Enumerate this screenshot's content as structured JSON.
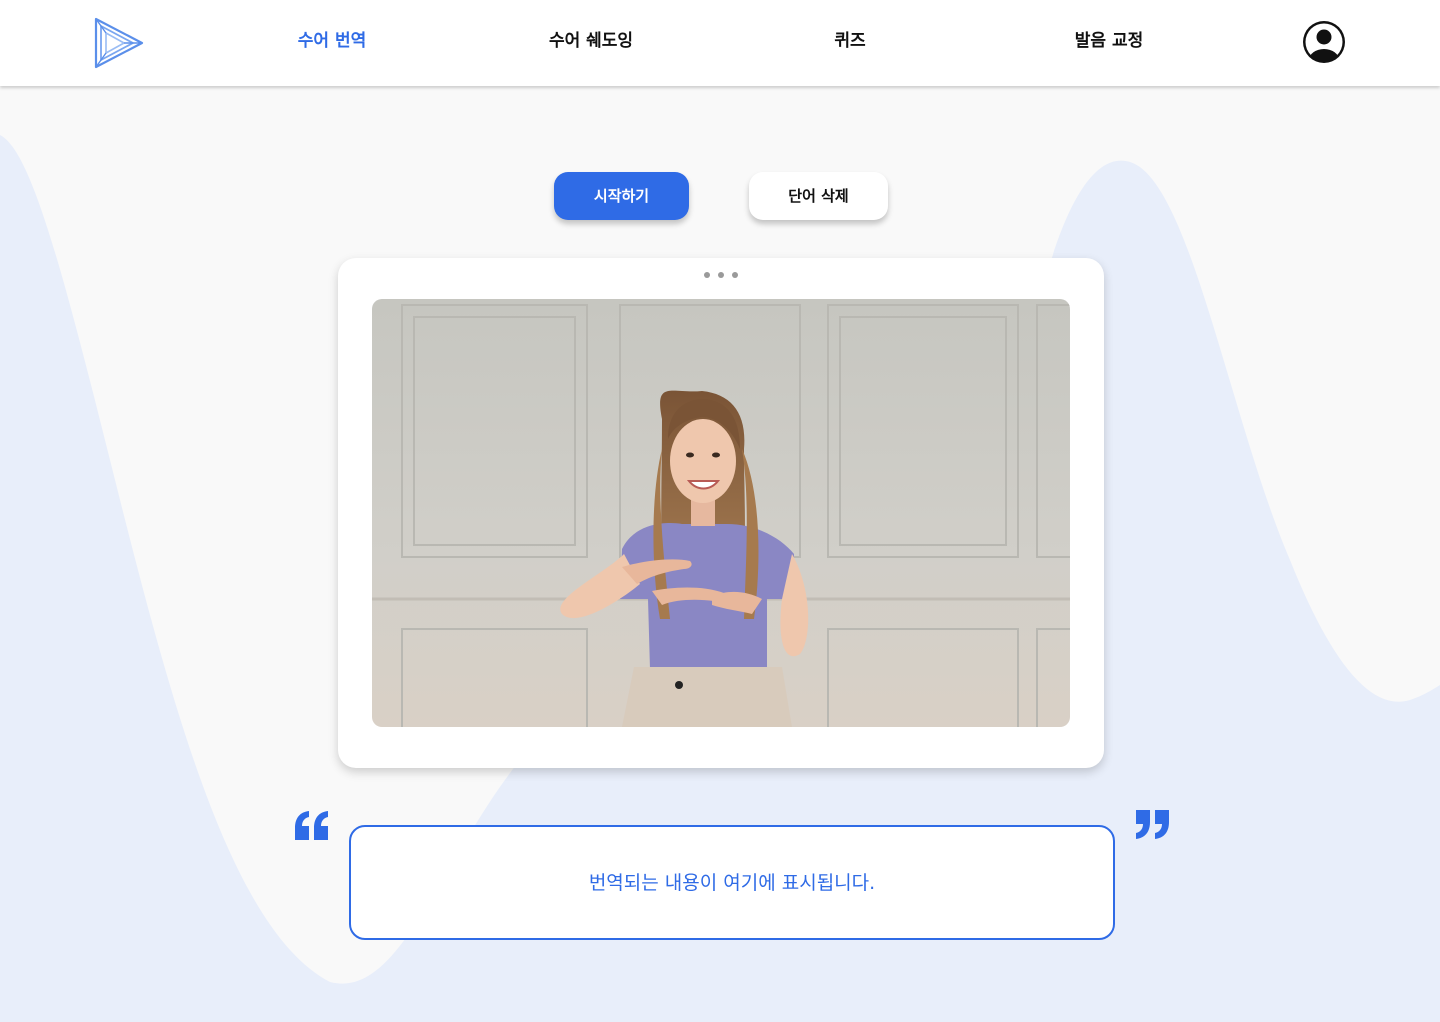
{
  "nav": {
    "items": [
      {
        "label": "수어 번역",
        "active": true
      },
      {
        "label": "수어 쉐도잉",
        "active": false
      },
      {
        "label": "퀴즈",
        "active": false
      },
      {
        "label": "발음 교정",
        "active": false
      }
    ],
    "logo_icon": "play-triangle-logo",
    "profile_icon": "user-avatar-icon"
  },
  "actions": {
    "start_label": "시작하기",
    "delete_label": "단어 삭제"
  },
  "video": {
    "menu_icon": "more-dots-icon",
    "content": "camera-feed-image"
  },
  "result": {
    "placeholder": "번역되는 내용이 여기에 표시됩니다."
  },
  "colors": {
    "accent": "#2f6be6",
    "wave": "#e8eefa",
    "background": "#f9f9f9"
  }
}
